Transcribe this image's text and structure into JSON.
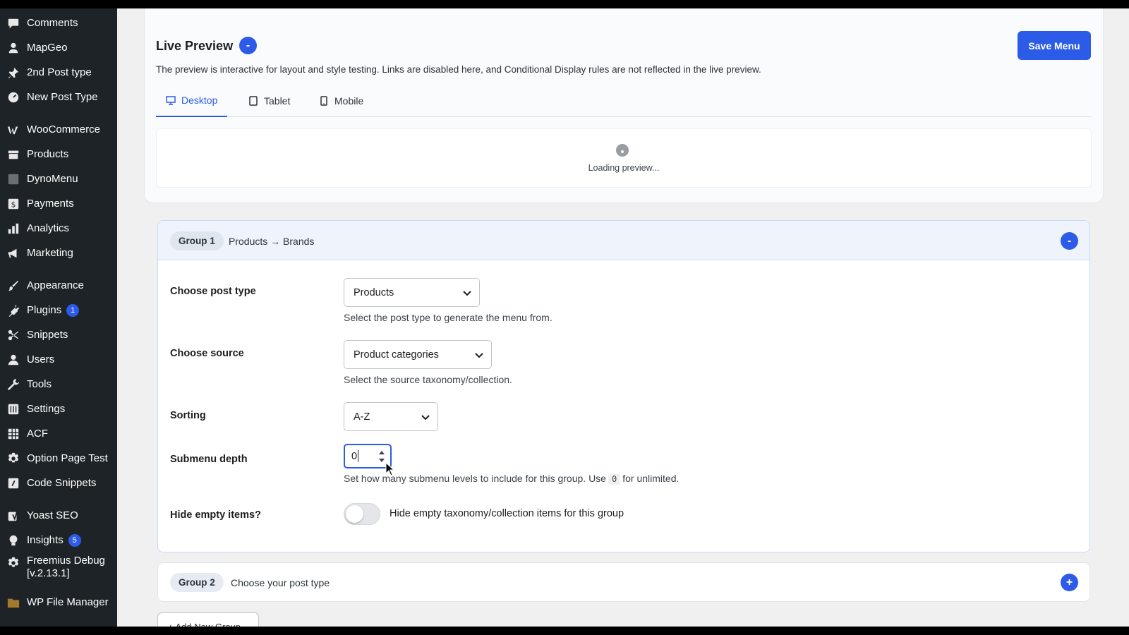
{
  "sidebar": {
    "items": [
      {
        "label": "Comments",
        "icon": "comments-icon"
      },
      {
        "label": "MapGeo",
        "icon": "map-pin-icon"
      },
      {
        "label": "2nd Post type",
        "icon": "pushpin-icon"
      },
      {
        "label": "New Post Type",
        "icon": "gauge-icon"
      },
      {
        "label": "WooCommerce",
        "icon": "woocommerce-icon"
      },
      {
        "label": "Products",
        "icon": "archive-icon"
      },
      {
        "label": "DynoMenu",
        "icon": "dynomenu-icon"
      },
      {
        "label": "Payments",
        "icon": "dollar-icon"
      },
      {
        "label": "Analytics",
        "icon": "bar-chart-icon"
      },
      {
        "label": "Marketing",
        "icon": "megaphone-icon"
      },
      {
        "label": "Appearance",
        "icon": "paintbrush-icon"
      },
      {
        "label": "Plugins",
        "icon": "plugin-icon",
        "badge": "1"
      },
      {
        "label": "Snippets",
        "icon": "scissors-icon"
      },
      {
        "label": "Users",
        "icon": "user-icon"
      },
      {
        "label": "Tools",
        "icon": "wrench-icon"
      },
      {
        "label": "Settings",
        "icon": "settings-sliders-icon"
      },
      {
        "label": "ACF",
        "icon": "grid-icon"
      },
      {
        "label": "Option Page Test",
        "icon": "gear-icon"
      },
      {
        "label": "Code Snippets",
        "icon": "code-icon"
      },
      {
        "label": "Yoast SEO",
        "icon": "yoast-icon"
      },
      {
        "label": "Insights",
        "icon": "insights-icon",
        "badge": "5"
      },
      {
        "label": "Freemius Debug",
        "label2": "[v.2.13.1]",
        "icon": "gear-icon"
      },
      {
        "label": "WP File Manager",
        "icon": "folder-icon"
      }
    ]
  },
  "preview": {
    "title": "Live Preview",
    "collapse_symbol": "-",
    "save_label": "Save Menu",
    "description": "The preview is interactive for layout and style testing. Links are disabled here, and Conditional Display rules are not reflected in the live preview.",
    "tabs": [
      {
        "label": "Desktop",
        "icon": "desktop-icon",
        "active": true
      },
      {
        "label": "Tablet",
        "icon": "tablet-icon"
      },
      {
        "label": "Mobile",
        "icon": "mobile-icon"
      }
    ],
    "loading_text": "Loading preview..."
  },
  "group1": {
    "pill": "Group 1",
    "subtitle": "Products → Brands",
    "collapse_symbol": "-",
    "post_type": {
      "label": "Choose post type",
      "value": "Products",
      "help": "Select the post type to generate the menu from."
    },
    "source": {
      "label": "Choose source",
      "value": "Product categories",
      "help": "Select the source taxonomy/collection."
    },
    "sorting": {
      "label": "Sorting",
      "value": "A-Z"
    },
    "depth": {
      "label": "Submenu depth",
      "value": "0",
      "help_before": "Set how many submenu levels to include for this group. Use",
      "help_code": "0",
      "help_after": "for unlimited."
    },
    "hide_empty": {
      "label": "Hide empty items?",
      "toggle_label": "Hide empty taxonomy/collection items for this group",
      "enabled": false
    }
  },
  "group2": {
    "pill": "Group 2",
    "subtitle": "Choose your post type",
    "expand_symbol": "+"
  },
  "add_group_label": "+ Add New Group",
  "colors": {
    "accent": "#2c5be8",
    "sidebar_bg": "#1d2327"
  }
}
